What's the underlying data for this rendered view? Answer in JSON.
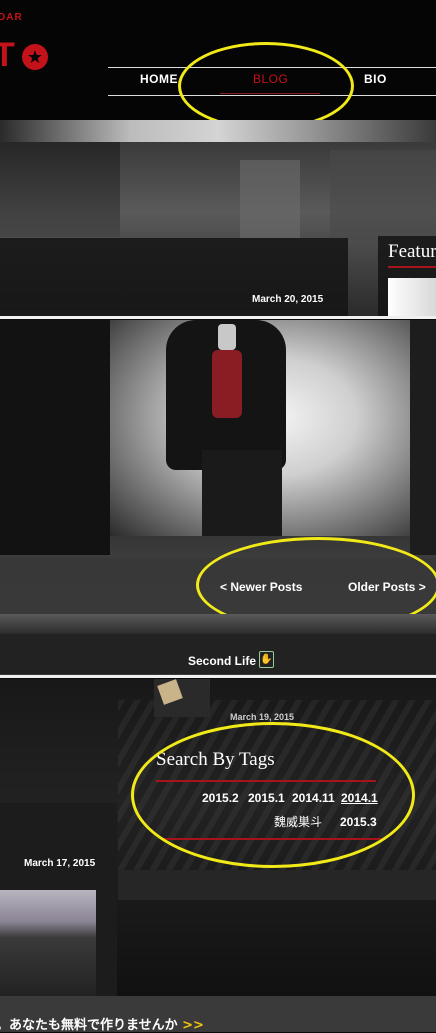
{
  "header": {
    "logo_small": "DAR",
    "logo_big": "T",
    "nav": {
      "home": "HOME",
      "blog": "BLOG",
      "bio": "BIO"
    }
  },
  "banner": {
    "post_date": "March 20, 2015",
    "featured_label": "Featur"
  },
  "post": {
    "pager": {
      "newer": "< Newer Posts",
      "older": "Older Posts >"
    },
    "label_link": "Second Life"
  },
  "sidebar": {
    "post_date_partial": "March 19, 2015",
    "search_tags_title": "Search By Tags",
    "tags": [
      "2015.2",
      "2015.1",
      "2014.11",
      "2014.1",
      "魏威巣斗",
      "2015.3"
    ],
    "post_date": "March 17, 2015"
  },
  "footer": {
    "text": "。あなたも無料で作りませんか",
    "arrow": ">>"
  },
  "colors": {
    "accent_red": "#c4121a",
    "highlight_yellow": "#f1ea18"
  }
}
